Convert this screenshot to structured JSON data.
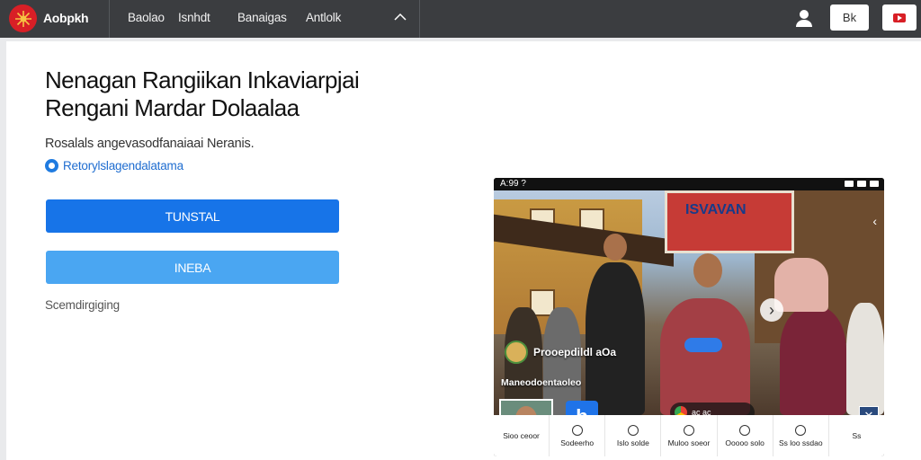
{
  "header": {
    "brand": "Aobpkh",
    "nav": [
      "Baolao",
      "Isnhdt",
      "Banaigas",
      "Antlolk"
    ],
    "light_button_label": "Bk"
  },
  "main": {
    "title_line1": "Nenagan Rangiikan  Inkaviarpjai",
    "title_line2": "Rengani Mardar Dolaalaa",
    "subtitle": "Rosalals angevasodfanaiaai Neranis.",
    "link_text": "Retorylslagendalatama",
    "primary_button": "TUNSTAL",
    "secondary_button": "INEBA",
    "footnote": "Scemdirgiging"
  },
  "phone": {
    "status_time": "A:99 ?",
    "banner_text": "ISVAVAN",
    "overlay_title": "Prooepdildl aOa",
    "overlay_sub": "Maneodoentaoleo",
    "play_badge": "b",
    "mini_text": "ac ac",
    "corner_glyph": "✕",
    "bottom_nav": [
      "Sioo ceoor",
      "Sodeerho",
      "Islo solde",
      "Muloo soeor",
      "Ooooo solo",
      "Ss loo ssdao",
      "Ss"
    ]
  },
  "colors": {
    "topbar": "#3b3d40",
    "brand_red": "#d81f26",
    "primary_blue": "#1774e8",
    "secondary_blue": "#4aa6f2",
    "link_blue": "#1f6dd0"
  },
  "icons": {
    "logo": "sunburst-logo-icon",
    "nav_chevron": "chevron-up-icon",
    "user": "user-icon",
    "play": "play-icon"
  }
}
